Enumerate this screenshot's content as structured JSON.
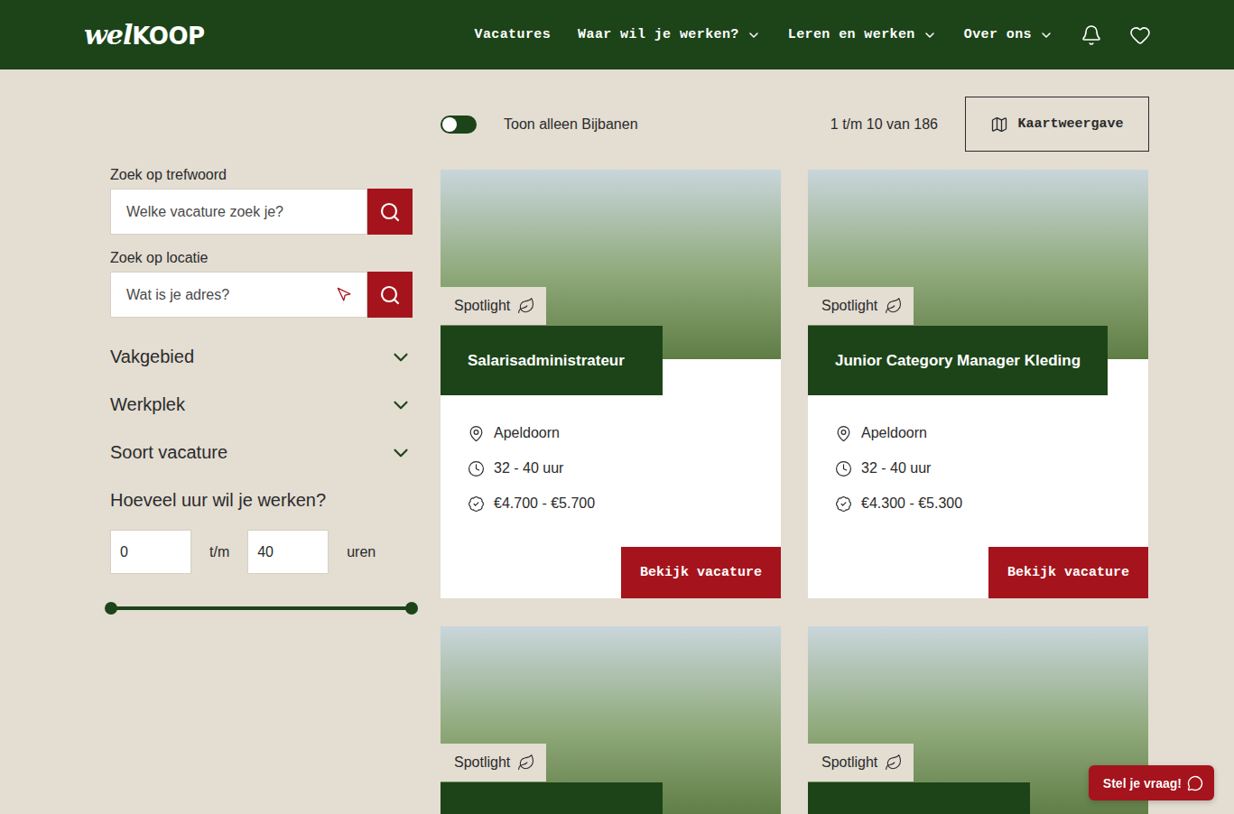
{
  "header": {
    "logo": {
      "script": "wel",
      "bold": "KOOP"
    },
    "nav": [
      {
        "label": "Vacatures",
        "dropdown": false
      },
      {
        "label": "Waar wil je werken?",
        "dropdown": true
      },
      {
        "label": "Leren en werken",
        "dropdown": true
      },
      {
        "label": "Over ons",
        "dropdown": true
      }
    ]
  },
  "filters": {
    "keyword": {
      "label": "Zoek op trefwoord",
      "placeholder": "Welke vacature zoek je?"
    },
    "location": {
      "label": "Zoek op locatie",
      "placeholder": "Wat is je adres?"
    },
    "groups": [
      {
        "label": "Vakgebied",
        "expanded": false
      },
      {
        "label": "Werkplek",
        "expanded": false
      },
      {
        "label": "Soort vacature",
        "expanded": false
      }
    ],
    "hours": {
      "label": "Hoeveel uur wil je werken?",
      "min": "0",
      "sep": "t/m",
      "max": "40",
      "unit": "uren",
      "low": 0,
      "level": 1
    }
  },
  "toolbar": {
    "toggle": {
      "label": "Toon alleen Bijbanen",
      "on": false
    },
    "count": "1 t/m 10 van 186",
    "map_button": "Kaartweergave"
  },
  "vacancies": [
    {
      "badge": "Spotlight",
      "title": "Salarisadministrateur",
      "location": "Apeldoorn",
      "hours": "32 - 40 uur",
      "salary": "€4.700 - €5.700",
      "button": "Bekijk vacature"
    },
    {
      "badge": "Spotlight",
      "title": "Junior Category Manager Kleding",
      "location": "Apeldoorn",
      "hours": "32 - 40 uur",
      "salary": "€4.300 - €5.300",
      "button": "Bekijk vacature"
    },
    {
      "badge": "Spotlight"
    },
    {
      "badge": "Spotlight"
    }
  ],
  "chat": {
    "label": "Stel je vraag!"
  }
}
